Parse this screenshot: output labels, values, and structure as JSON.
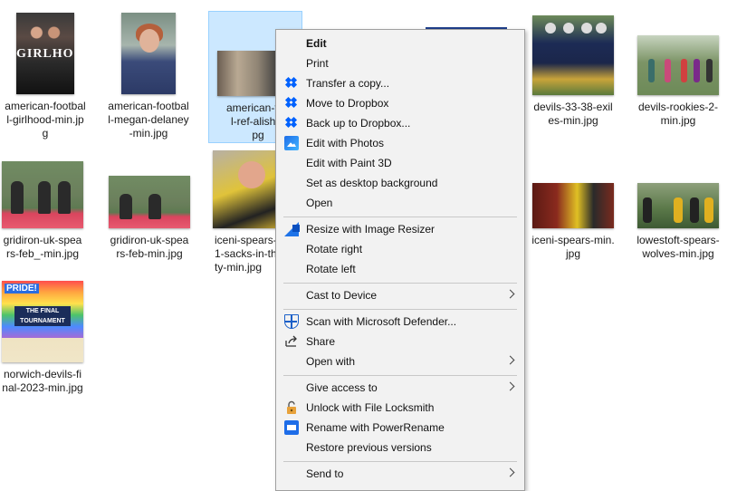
{
  "files": [
    {
      "name": "american-football-girlhood-min.jpg",
      "lines": [
        "american-footbal",
        "l-girlhood-min.jp",
        "g"
      ],
      "thumb_text": "GIRLHOOD"
    },
    {
      "name": "american-football-megan-delaney-min.jpg",
      "lines": [
        "american-footbal",
        "l-megan-delaney",
        "-min.jpg"
      ]
    },
    {
      "name": "american-football-ref-alisha-min.jpg",
      "lines": [
        "american-foo",
        "l-ref-alisha-",
        "pg"
      ],
      "selected": true
    },
    {
      "name": "devils-33-38-exiles-min.jpg",
      "lines": [
        "devils-33-38-exil",
        "es-min.jpg"
      ]
    },
    {
      "name": "devils-rookies-2-min.jpg",
      "lines": [
        "devils-rookies-2-",
        "min.jpg"
      ]
    },
    {
      "name": "gridiron-uk-spears-feb_-min.jpg",
      "lines": [
        "gridiron-uk-spea",
        "rs-feb_-min.jpg"
      ]
    },
    {
      "name": "gridiron-uk-spears-feb-min.jpg",
      "lines": [
        "gridiron-uk-spea",
        "rs-feb-min.jpg"
      ]
    },
    {
      "name": "iceni-spears-1-sacks-in-thirty-min.jpg",
      "lines": [
        "iceni-spears-",
        "1-sacks-in-th",
        "ty-min.jpg"
      ]
    },
    {
      "name": "iceni-spears-min.jpg",
      "lines": [
        "iceni-spears-min.",
        "jpg"
      ]
    },
    {
      "name": "lowestoft-spears-wolves-min.jpg",
      "lines": [
        "lowestoft-spears-",
        "wolves-min.jpg"
      ]
    },
    {
      "name": "norwich-devils-final-2023-min.jpg",
      "lines": [
        "norwich-devils-fi",
        "nal-2023-min.jpg"
      ],
      "thumb_text": "PRIDE!",
      "thumb_banner": "THE FINAL TOURNAMENT"
    }
  ],
  "menu": {
    "items": [
      {
        "label": "Edit",
        "icon": null,
        "bold": true
      },
      {
        "label": "Print",
        "icon": null
      },
      {
        "label": "Transfer a copy...",
        "icon": "dropbox-icon"
      },
      {
        "label": "Move to Dropbox",
        "icon": "dropbox-icon"
      },
      {
        "label": "Back up to Dropbox...",
        "icon": "dropbox-icon"
      },
      {
        "label": "Edit with Photos",
        "icon": "photos-icon"
      },
      {
        "label": "Edit with Paint 3D",
        "icon": null
      },
      {
        "label": "Set as desktop background",
        "icon": null
      },
      {
        "label": "Open",
        "icon": null
      },
      {
        "label": "Resize with Image Resizer",
        "icon": "image-resizer-icon"
      },
      {
        "label": "Rotate right",
        "icon": null
      },
      {
        "label": "Rotate left",
        "icon": null
      },
      {
        "label": "Cast to Device",
        "icon": null,
        "submenu": true
      },
      {
        "label": "Scan with Microsoft Defender...",
        "icon": "defender-icon"
      },
      {
        "label": "Share",
        "icon": "share-icon"
      },
      {
        "label": "Open with",
        "icon": null,
        "submenu": true
      },
      {
        "label": "Give access to",
        "icon": null,
        "submenu": true
      },
      {
        "label": "Unlock with File Locksmith",
        "icon": "lock-icon"
      },
      {
        "label": "Rename with PowerRename",
        "icon": "powerrename-icon"
      },
      {
        "label": "Restore previous versions",
        "icon": null
      },
      {
        "label": "Send to",
        "icon": null,
        "submenu": true
      }
    ]
  },
  "colors": {
    "selection_fill": "#cce8ff",
    "selection_border": "#99d1ff",
    "menu_bg": "#f2f2f2",
    "dropbox_blue": "#0061fe"
  }
}
